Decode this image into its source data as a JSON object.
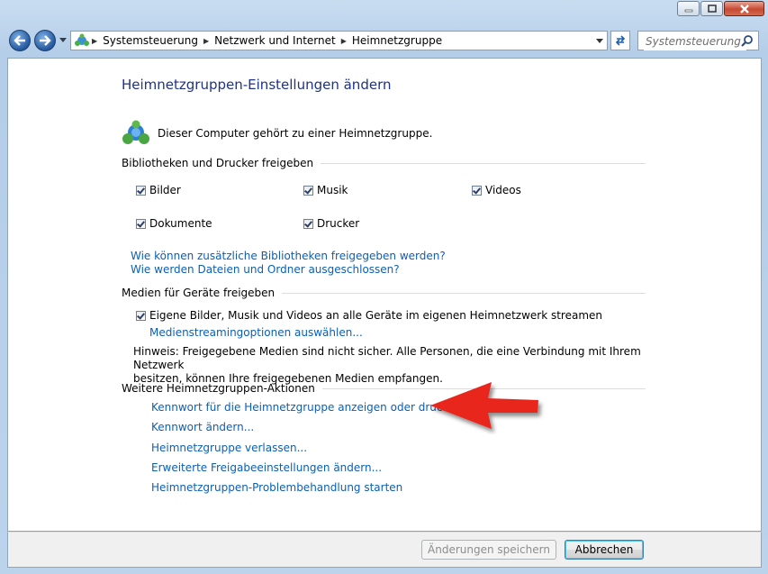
{
  "window": {
    "buttons": [
      "minimize",
      "maximize",
      "close"
    ]
  },
  "address_bar": {
    "crumbs": [
      "Systemsteuerung",
      "Netzwerk und Internet",
      "Heimnetzgruppe"
    ],
    "search_placeholder": "Systemsteuerung ..."
  },
  "page": {
    "title": "Heimnetzgruppen-Einstellungen ändern",
    "homegroup_status": "Dieser Computer gehört zu einer Heimnetzgruppe."
  },
  "libraries": {
    "heading": "Bibliotheken und Drucker freigeben",
    "items": [
      {
        "label": "Bilder",
        "checked": true
      },
      {
        "label": "Musik",
        "checked": true
      },
      {
        "label": "Videos",
        "checked": true
      },
      {
        "label": "Dokumente",
        "checked": true
      },
      {
        "label": "Drucker",
        "checked": true
      }
    ],
    "link_more_libraries": "Wie können zusätzliche Bibliotheken freigegeben werden?",
    "link_excluded": "Wie werden Dateien und Ordner ausgeschlossen?"
  },
  "media": {
    "heading": "Medien für Geräte freigeben",
    "stream_label": "Eigene Bilder, Musik und Videos an alle Geräte im eigenen Heimnetzwerk streamen",
    "stream_checked": true,
    "link_streaming_options": "Medienstreamingoptionen auswählen...",
    "hint_line1": "Hinweis: Freigegebene Medien sind nicht sicher. Alle Personen, die eine Verbindung mit Ihrem Netzwerk",
    "hint_line2": "besitzen, können Ihre freigegebenen Medien empfangen."
  },
  "actions": {
    "heading": "Weitere Heimnetzgruppen-Aktionen",
    "links": [
      "Kennwort für die Heimnetzgruppe anzeigen oder drucken",
      "Kennwort ändern...",
      "Heimnetzgruppe verlassen...",
      "Erweiterte Freigabeeinstellungen ändern...",
      "Heimnetzgruppen-Problembehandlung starten"
    ]
  },
  "footer": {
    "save_label": "Änderungen speichern",
    "save_enabled": false,
    "cancel_label": "Abbrechen"
  },
  "colors": {
    "link": "#0b5fb5",
    "title": "#1e3287",
    "annotation_arrow": "#e8261e"
  }
}
